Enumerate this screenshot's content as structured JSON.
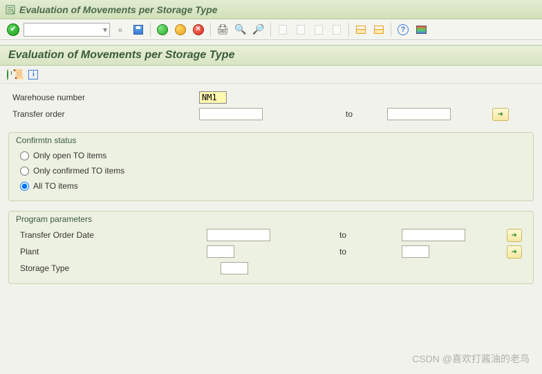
{
  "window": {
    "title": "Evaluation of Movements per Storage Type"
  },
  "subheader": {
    "title": "Evaluation of Movements per Storage Type"
  },
  "fields": {
    "warehouse_number": {
      "label": "Warehouse number",
      "value": "NM1"
    },
    "transfer_order": {
      "label": "Transfer order",
      "value_from": "",
      "to_label": "to",
      "value_to": ""
    }
  },
  "confirm_status": {
    "legend": "Confirmtn status",
    "options": {
      "open": "Only open TO items",
      "confirmed": "Only confirmed TO items",
      "all": "All TO items"
    },
    "selected": "all"
  },
  "program_params": {
    "legend": "Program parameters",
    "transfer_order_date": {
      "label": "Transfer Order Date",
      "value_from": "",
      "to_label": "to",
      "value_to": ""
    },
    "plant": {
      "label": "Plant",
      "value_from": "",
      "to_label": "to",
      "value_to": ""
    },
    "storage_type": {
      "label": "Storage Type",
      "value": ""
    }
  },
  "watermark": "CSDN @喜欢打酱油的老鸟"
}
